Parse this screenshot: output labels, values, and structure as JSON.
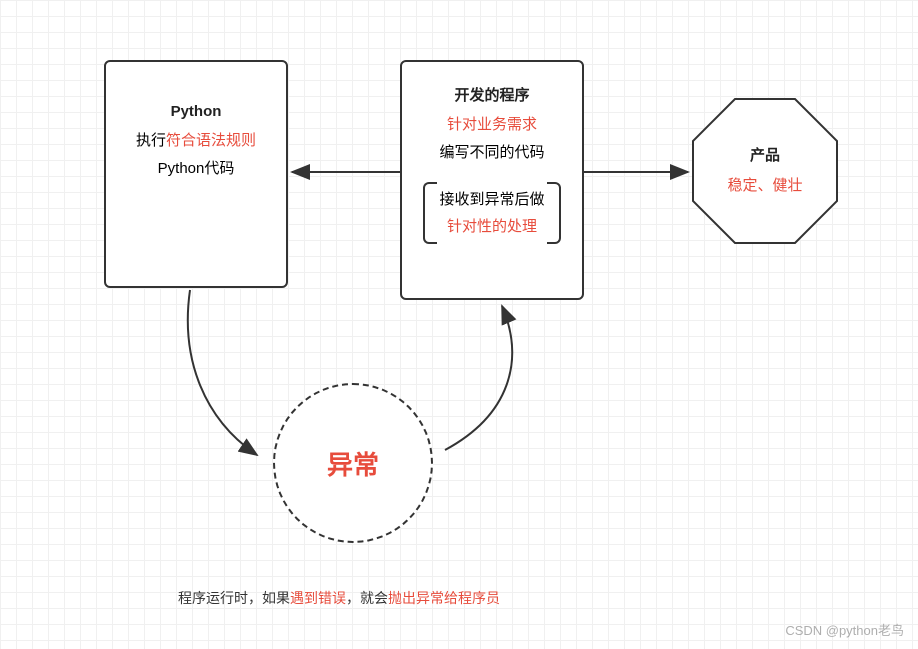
{
  "diagram": {
    "python_box": {
      "title": "Python",
      "line1a": "执行",
      "line1b": "符合语法规则",
      "line2": "Python代码"
    },
    "dev_box": {
      "title": "开发的程序",
      "sub1": "针对业务需求",
      "sub2": "编写不同的代码",
      "bracket1": "接收到异常后做",
      "bracket2": "针对性的处理"
    },
    "product": {
      "title": "产品",
      "sub": "稳定、健壮"
    },
    "exception": {
      "label": "异常"
    },
    "caption": {
      "p1": "程序运行时，如果",
      "p2": "遇到错误",
      "p3": "，就会",
      "p4": "抛出异常给程序员"
    },
    "watermark": "CSDN @python老鸟"
  }
}
